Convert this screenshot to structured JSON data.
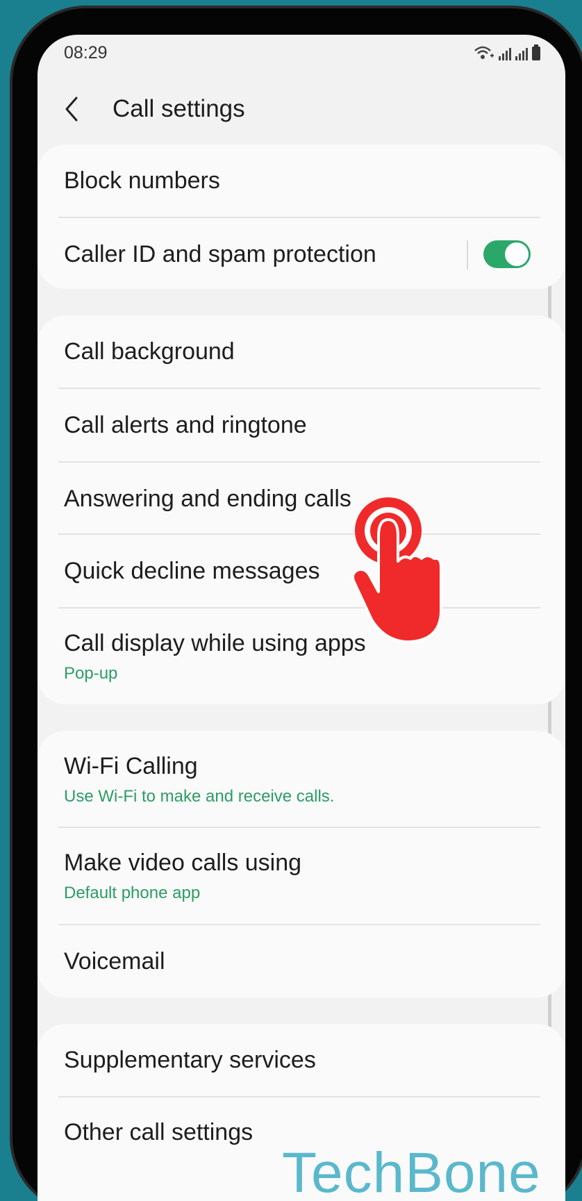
{
  "status_bar": {
    "time": "08:29"
  },
  "header": {
    "title": "Call settings"
  },
  "groups": [
    {
      "items": [
        {
          "title": "Block numbers"
        },
        {
          "title": "Caller ID and spam protection",
          "toggle": true
        }
      ]
    },
    {
      "items": [
        {
          "title": "Call background"
        },
        {
          "title": "Call alerts and ringtone"
        },
        {
          "title": "Answering and ending calls"
        },
        {
          "title": "Quick decline messages"
        },
        {
          "title": "Call display while using apps",
          "subtitle": "Pop-up"
        }
      ]
    },
    {
      "items": [
        {
          "title": "Wi-Fi Calling",
          "subtitle": "Use Wi-Fi to make and receive calls."
        },
        {
          "title": "Make video calls using",
          "subtitle": "Default phone app"
        },
        {
          "title": "Voicemail"
        }
      ]
    },
    {
      "items": [
        {
          "title": "Supplementary services"
        },
        {
          "title": "Other call settings"
        }
      ]
    }
  ],
  "watermark": "TechBone",
  "colors": {
    "background": "#1a7f8e",
    "accent_green": "#2aa86a",
    "subtitle_green": "#2a9d63",
    "tap_hand": "#f02a2a",
    "watermark": "#5ab8cc"
  },
  "icons": [
    "back-arrow-icon",
    "wifi-calling-icon",
    "signal-icon",
    "battery-icon",
    "tap-hand-icon"
  ]
}
